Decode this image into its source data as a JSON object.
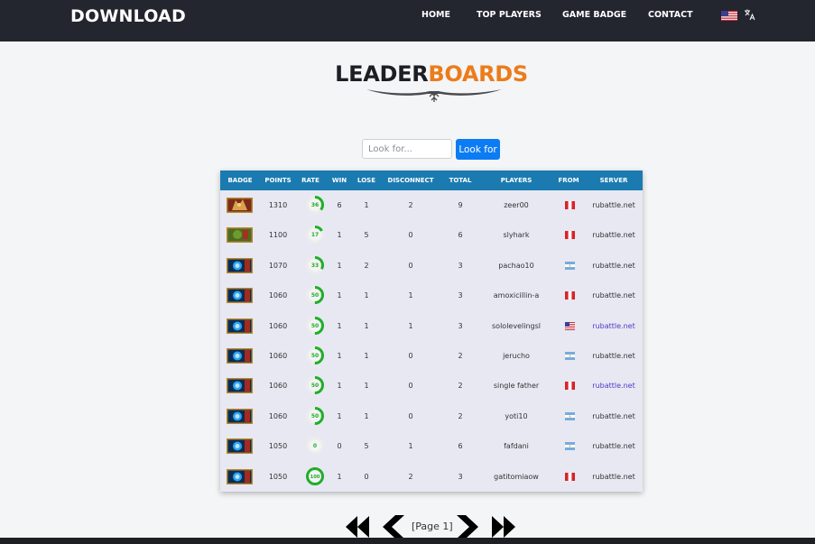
{
  "header": {
    "brand": "DOWNLOAD",
    "nav": [
      "HOME",
      "TOP PLAYERS",
      "GAME BADGE",
      "CONTACT"
    ],
    "language_flag": "us-flag",
    "translate_icon": "translate-icon",
    "background": "#23252f"
  },
  "page": {
    "title_part1": "LEADER",
    "title_part2": "BOARDS",
    "title_accent_color": "#eb7c1a"
  },
  "search": {
    "placeholder": "Look for...",
    "value": "",
    "button_label": "Look for",
    "button_color": "#0b7cf3"
  },
  "table": {
    "header_color": "#1b7bb0",
    "columns": [
      "BADGE",
      "POINTS",
      "RATE",
      "WIN",
      "LOSE",
      "DISCONNECT",
      "TOTAL",
      "PLAYERS",
      "FROM",
      "SERVER"
    ],
    "rows": [
      {
        "badge": "rank-badge-hero",
        "points": "1310",
        "rate": "36",
        "win": "6",
        "lose": "1",
        "disconnect": "2",
        "total": "9",
        "player": "zeer00",
        "from": "peru-flag",
        "server": "rubattle.net",
        "server_link": false
      },
      {
        "badge": "rank-badge-orc",
        "points": "1100",
        "rate": "17",
        "win": "1",
        "lose": "5",
        "disconnect": "0",
        "total": "6",
        "player": "slyhark",
        "from": "peru-flag",
        "server": "rubattle.net",
        "server_link": false
      },
      {
        "badge": "rank-badge-blue",
        "points": "1070",
        "rate": "33",
        "win": "1",
        "lose": "2",
        "disconnect": "0",
        "total": "3",
        "player": "pachao10",
        "from": "argentina-flag",
        "server": "rubattle.net",
        "server_link": false
      },
      {
        "badge": "rank-badge-blue",
        "points": "1060",
        "rate": "50",
        "win": "1",
        "lose": "1",
        "disconnect": "1",
        "total": "3",
        "player": "amoxicillin-a",
        "from": "peru-flag",
        "server": "rubattle.net",
        "server_link": false
      },
      {
        "badge": "rank-badge-blue",
        "points": "1060",
        "rate": "50",
        "win": "1",
        "lose": "1",
        "disconnect": "1",
        "total": "3",
        "player": "sololevelingsl",
        "from": "us-flag",
        "server": "rubattle.net",
        "server_link": true
      },
      {
        "badge": "rank-badge-blue",
        "points": "1060",
        "rate": "50",
        "win": "1",
        "lose": "1",
        "disconnect": "0",
        "total": "2",
        "player": "jerucho",
        "from": "argentina-flag",
        "server": "rubattle.net",
        "server_link": false
      },
      {
        "badge": "rank-badge-blue",
        "points": "1060",
        "rate": "50",
        "win": "1",
        "lose": "1",
        "disconnect": "0",
        "total": "2",
        "player": "single father",
        "from": "peru-flag",
        "server": "rubattle.net",
        "server_link": true
      },
      {
        "badge": "rank-badge-blue",
        "points": "1060",
        "rate": "50",
        "win": "1",
        "lose": "1",
        "disconnect": "0",
        "total": "2",
        "player": "yoti10",
        "from": "argentina-flag",
        "server": "rubattle.net",
        "server_link": false
      },
      {
        "badge": "rank-badge-blue",
        "points": "1050",
        "rate": "0",
        "win": "0",
        "lose": "5",
        "disconnect": "1",
        "total": "6",
        "player": "fafdani",
        "from": "argentina-flag",
        "server": "rubattle.net",
        "server_link": false
      },
      {
        "badge": "rank-badge-blue",
        "points": "1050",
        "rate": "100",
        "win": "1",
        "lose": "0",
        "disconnect": "2",
        "total": "3",
        "player": "gatitomiaow",
        "from": "peru-flag",
        "server": "rubattle.net",
        "server_link": false
      }
    ]
  },
  "pagination": {
    "first_icon": "double-chevron-left-icon",
    "prev_icon": "chevron-left-icon",
    "label": "[Page 1]",
    "next_icon": "chevron-right-icon",
    "last_icon": "double-chevron-right-icon"
  },
  "colors": {
    "rate_ring": "#1fae2a",
    "rate_track": "#ececec",
    "link": "#4b3cc8"
  }
}
